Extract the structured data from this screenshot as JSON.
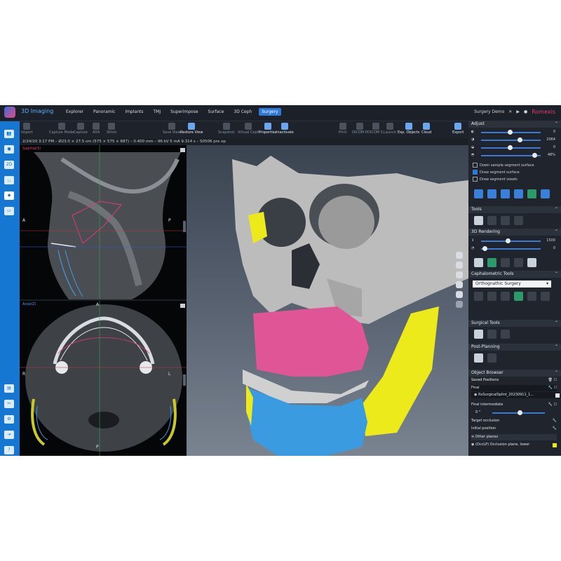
{
  "app": {
    "title": "3D Imaging"
  },
  "nav_tabs": [
    "Explorer",
    "Panoramic",
    "Implants",
    "TMJ",
    "Superimpose",
    "Surface",
    "3D Ceph",
    "Surgery"
  ],
  "active_tab": "Surgery",
  "header_right": {
    "case": "Surgery Demo",
    "brand": "Romexis"
  },
  "toolbar": {
    "import": "Import",
    "capture_model": "Capture Model",
    "capture": "Capture",
    "axa": "AXA",
    "stitch": "Stitch",
    "save_view": "Save View",
    "restore_view": "Restore View",
    "snapshot": "Snapshot",
    "virtual_ceph": "Virtual Ceph",
    "properties": "Properties",
    "inactivate": "Inactivate",
    "print": "Print",
    "dicom_p": "DICOM P.",
    "dicom_s": "DICOM S.",
    "launch": "Launch",
    "exp_objects": "Exp. Objects",
    "cloud": "Cloud",
    "export": "Export"
  },
  "info_bar": "2/24/20 3:17 PM – Ø23.0 × 27.5 cm (575 × 575 × 687) – 0.400 mm – 96 kV 5 mA 9.314 s – S0506 pre op",
  "sagittal": {
    "label": "Sagittal(S)",
    "left": "A",
    "right": "P"
  },
  "axial": {
    "label": "Axial(Z)",
    "top": "A",
    "left": "R",
    "right": "L",
    "bottom": "P"
  },
  "adjust": {
    "title": "Adjust",
    "sliders": [
      {
        "value": "0",
        "level": 0.45
      },
      {
        "value": "2064",
        "level": 0.62
      },
      {
        "value": "0",
        "level": 0.45
      },
      {
        "value": "48%",
        "level": 0.86
      }
    ],
    "checks": [
      {
        "label": "Down sample segment surface",
        "checked": false
      },
      {
        "label": "Draw segment surface",
        "checked": true
      },
      {
        "label": "Draw segment voxels",
        "checked": false
      }
    ]
  },
  "tools": {
    "title": "Tools"
  },
  "rendering": {
    "title": "3D Rendering",
    "sliders": [
      {
        "value": "1500",
        "level": 0.42
      },
      {
        "value": "0",
        "level": 0.04
      }
    ]
  },
  "ceph": {
    "title": "Cephalometric Tools",
    "dropdown": "Orthognathic Surgery"
  },
  "surgical": {
    "title": "Surgical Tools"
  },
  "post_planning": {
    "title": "Post-Planning"
  },
  "object_browser": {
    "title": "Object Browser",
    "saved_positions": "Saved Positions",
    "final": "Final",
    "splint": "RxSurgicalSplint_20230911_1...",
    "final_intermediate": "Final intermediate",
    "angle": "0 °",
    "target_occlusion": "Target occlusion",
    "initial_position": "Initial position",
    "other_planes": "Other planes",
    "occlusion_plane": "(OccLP) Occlusion plane, lower"
  },
  "colors": {
    "accent": "#2d79d9",
    "brand": "#e2397a",
    "maxilla": "#e05596",
    "mandible": "#3a9be0",
    "ramus": "#ecea1a"
  }
}
